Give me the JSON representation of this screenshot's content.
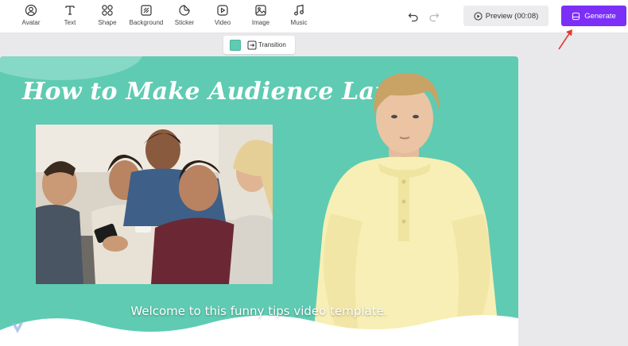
{
  "toolbar": {
    "items": [
      {
        "label": "Avatar",
        "icon": "avatar-icon"
      },
      {
        "label": "Text",
        "icon": "text-icon"
      },
      {
        "label": "Shape",
        "icon": "shape-icon"
      },
      {
        "label": "Background",
        "icon": "background-icon"
      },
      {
        "label": "Sticker",
        "icon": "sticker-icon"
      },
      {
        "label": "Video",
        "icon": "video-icon"
      },
      {
        "label": "Image",
        "icon": "image-icon"
      },
      {
        "label": "Music",
        "icon": "music-icon"
      }
    ],
    "undo_icon": "undo-icon",
    "redo_icon": "redo-icon",
    "preview_label": "Preview (00:08)",
    "generate_label": "Generate",
    "accent": "#7b2ff7"
  },
  "element_bar": {
    "color": "#5ecbb3",
    "transition_label": "Transition"
  },
  "canvas": {
    "background": "#5fcbb2",
    "title": "How to Make Audience Laugh",
    "subtitle": "Welcome to this funny tips video template.",
    "photo": "group-of-friends-laughing-at-phone",
    "presenter": "avatar-presenter"
  }
}
